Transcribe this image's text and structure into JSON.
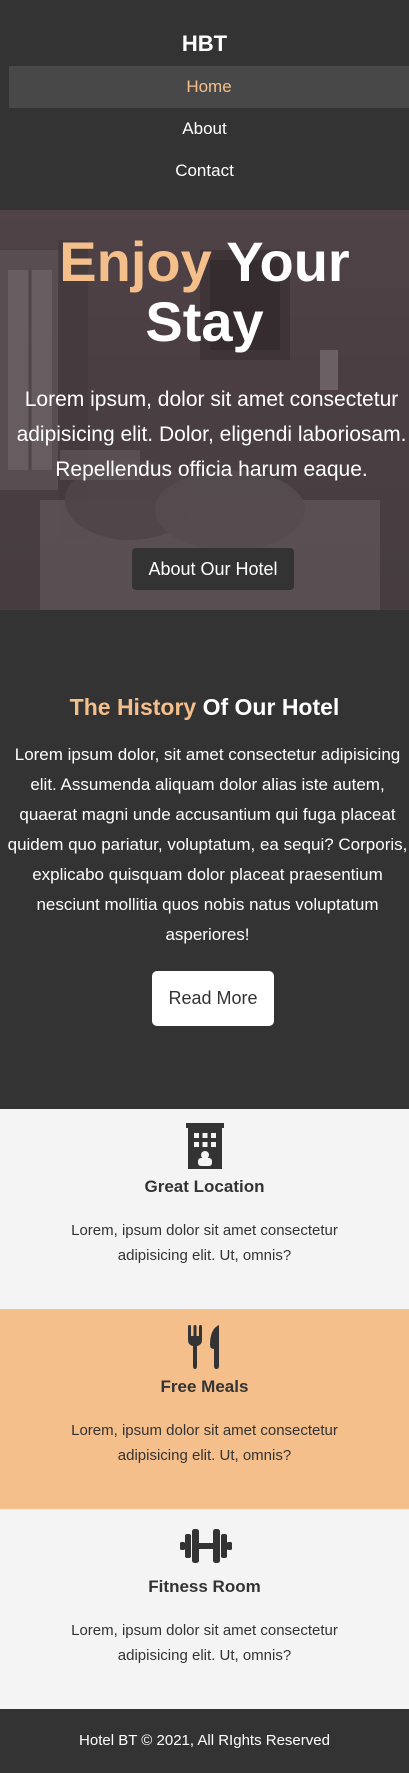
{
  "nav": {
    "brand": "HBT",
    "items": [
      {
        "label": "Home",
        "active": true
      },
      {
        "label": "About",
        "active": false
      },
      {
        "label": "Contact",
        "active": false
      }
    ]
  },
  "hero": {
    "title_accent": "Enjoy",
    "title_rest": "Your Stay",
    "text": "Lorem ipsum, dolor sit amet consectetur adipisicing elit. Dolor, eligendi laboriosam. Repellendus officia harum eaque.",
    "button_label": "About Our Hotel"
  },
  "history": {
    "title_accent": "The History",
    "title_rest": "Of Our Hotel",
    "text": "Lorem ipsum dolor, sit amet consectetur adipisicing elit. Assumenda aliquam dolor alias iste autem, quaerat magni unde accusantium qui fuga placeat quidem quo pariatur, voluptatum, ea sequi? Corporis, explicabo quisquam dolor placeat praesentium nesciunt mollitia quos nobis natus voluptatum asperiores!",
    "button_label": "Read More"
  },
  "features": [
    {
      "icon": "hotel-icon",
      "title": "Great Location",
      "text": "Lorem, ipsum dolor sit amet consectetur adipisicing elit. Ut, omnis?"
    },
    {
      "icon": "utensils-icon",
      "title": "Free Meals",
      "text": "Lorem, ipsum dolor sit amet consectetur adipisicing elit. Ut, omnis?"
    },
    {
      "icon": "dumbbell-icon",
      "title": "Fitness Room",
      "text": "Lorem, ipsum dolor sit amet consectetur adipisicing elit. Ut, omnis?"
    }
  ],
  "footer": {
    "text": "Hotel BT © 2021, All RIghts Reserved"
  },
  "colors": {
    "accent": "#f5bf8b",
    "dark": "#333333",
    "light": "#f4f4f4"
  }
}
